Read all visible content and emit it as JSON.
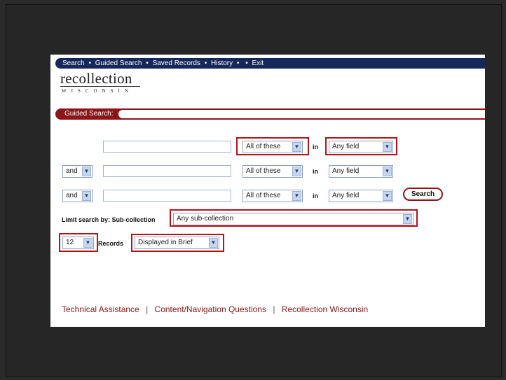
{
  "nav": {
    "items": [
      "Search",
      "Guided Search",
      "Saved Records",
      "History",
      "",
      "Exit"
    ],
    "separator": "•"
  },
  "logo": {
    "main": "recollection",
    "sub": "WISCONSIN"
  },
  "guided_search": {
    "label": "Guided Search:"
  },
  "rows": [
    {
      "bool": "",
      "match": "All of these",
      "in_label": "in",
      "field": "Any field"
    },
    {
      "bool": "and",
      "match": "All of these",
      "in_label": "in",
      "field": "Any field"
    },
    {
      "bool": "and",
      "match": "All of these",
      "in_label": "in",
      "field": "Any field"
    }
  ],
  "search_button": "Search",
  "limit": {
    "label": "Limit search by: Sub-collection",
    "value": "Any sub-collection"
  },
  "records": {
    "count": "12",
    "label": "Records",
    "display": "Displayed in Brief"
  },
  "footer": {
    "links": [
      "Technical Assistance",
      "Content/Navigation Questions",
      "Recollection Wisconsin"
    ],
    "separator": "|"
  },
  "colors": {
    "nav_bg": "#16285a",
    "accent": "#8c1518",
    "highlight": "#b3141b"
  }
}
